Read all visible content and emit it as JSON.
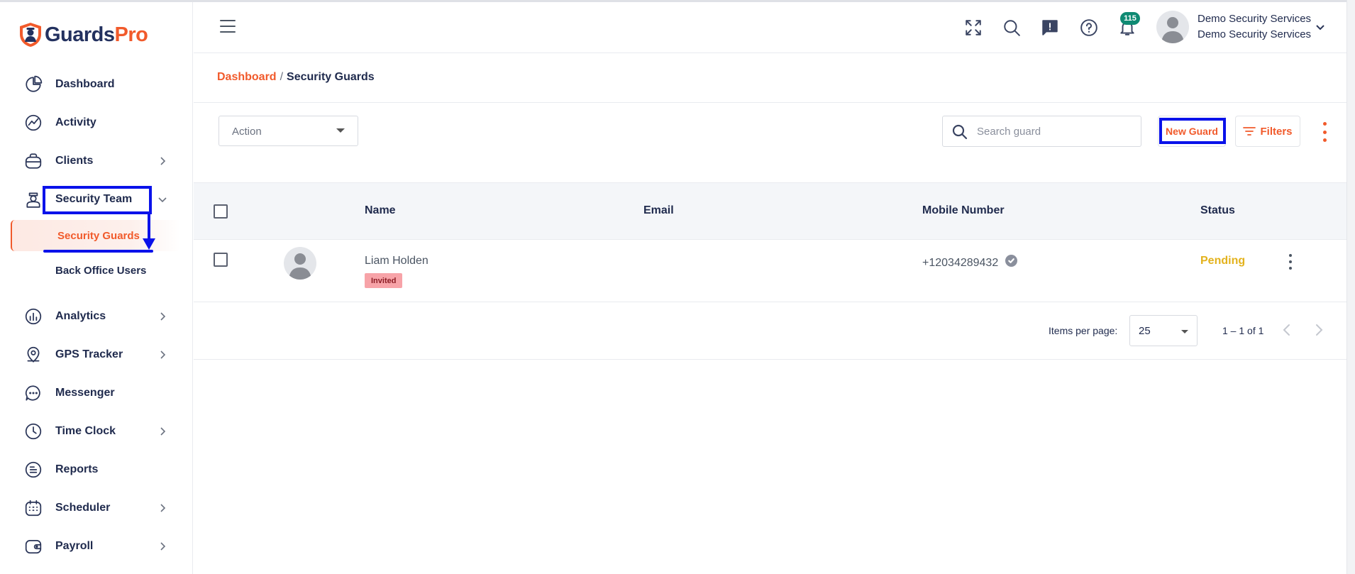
{
  "brand": {
    "name_part1": "Guards",
    "name_part2": "Pro",
    "colors": {
      "primary": "#f15a2b",
      "navy": "#23315f",
      "annotation": "#0a12ea"
    }
  },
  "sidebar": {
    "items": [
      {
        "label": "Dashboard",
        "icon": "pie-chart-icon",
        "has_chevron": false
      },
      {
        "label": "Activity",
        "icon": "activity-icon",
        "has_chevron": false
      },
      {
        "label": "Clients",
        "icon": "briefcase-icon",
        "has_chevron": true
      },
      {
        "label": "Security Team",
        "icon": "guard-icon",
        "has_chevron": true,
        "expanded": true
      },
      {
        "label": "Analytics",
        "icon": "analytics-icon",
        "has_chevron": true
      },
      {
        "label": "GPS Tracker",
        "icon": "location-icon",
        "has_chevron": true
      },
      {
        "label": "Messenger",
        "icon": "chat-icon",
        "has_chevron": false
      },
      {
        "label": "Time Clock",
        "icon": "clock-icon",
        "has_chevron": true
      },
      {
        "label": "Reports",
        "icon": "reports-icon",
        "has_chevron": false
      },
      {
        "label": "Scheduler",
        "icon": "calendar-icon",
        "has_chevron": true
      },
      {
        "label": "Payroll",
        "icon": "wallet-icon",
        "has_chevron": true
      }
    ],
    "sub_items": [
      {
        "label": "Security Guards",
        "active": true
      },
      {
        "label": "Back Office Users",
        "active": false
      }
    ]
  },
  "topbar": {
    "notification_count": "115",
    "user": {
      "name": "Demo Security Services",
      "company": "Demo Security Services"
    }
  },
  "breadcrumb": {
    "root": "Dashboard",
    "separator": "/",
    "current": "Security Guards"
  },
  "toolbar": {
    "action_select": "Action",
    "search_placeholder": "Search guard",
    "new_guard_label": "New Guard",
    "filters_label": "Filters"
  },
  "table": {
    "headers": {
      "name": "Name",
      "email": "Email",
      "mobile": "Mobile Number",
      "status": "Status"
    },
    "rows": [
      {
        "name": "Liam Holden",
        "badge": "Invited",
        "email": "",
        "mobile": "+12034289432",
        "verified": true,
        "status": "Pending"
      }
    ]
  },
  "pagination": {
    "items_per_page_label": "Items per page:",
    "items_per_page": "25",
    "range": "1 – 1 of 1"
  }
}
